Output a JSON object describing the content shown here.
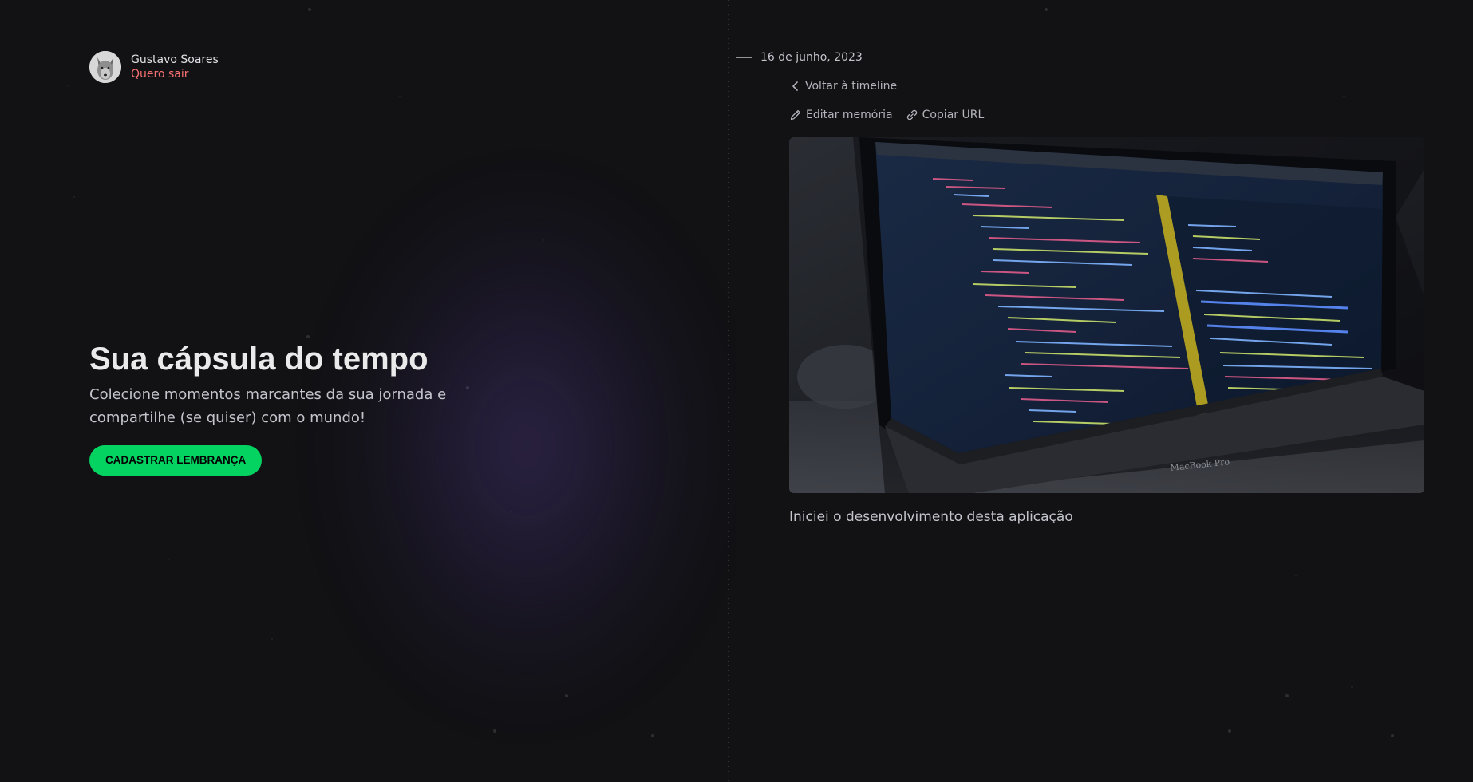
{
  "user": {
    "name": "Gustavo Soares",
    "logout_label": "Quero sair"
  },
  "hero": {
    "title": "Sua cápsula do tempo",
    "subtitle": "Colecione momentos marcantes da sua jornada e compartilhe (se quiser) com o mundo!",
    "cta_label": "CADASTRAR LEMBRANÇA"
  },
  "memory": {
    "date": "16 de junho, 2023",
    "back_label": "Voltar à timeline",
    "edit_label": "Editar memória",
    "copy_label": "Copiar URL",
    "caption": "Iniciei o desenvolvimento desta aplicação",
    "laptop_brand": "MacBook Pro"
  },
  "colors": {
    "accent": "#04d361",
    "logout": "#f87171",
    "background": "#121215"
  },
  "icons": {
    "back": "chevron-left-icon",
    "edit": "pencil-icon",
    "copy": "link-icon"
  }
}
